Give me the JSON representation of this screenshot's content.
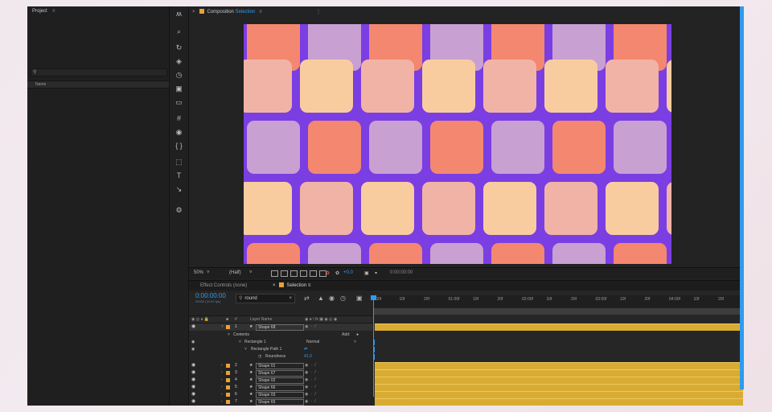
{
  "project": {
    "title": "Project",
    "search_placeholder": "",
    "column_name": "Name"
  },
  "tools": [
    {
      "icon": "puppet-pin-icon",
      "glyph": "ʍ"
    },
    {
      "icon": "search-icon",
      "glyph": "⌕"
    },
    {
      "icon": "rotate-icon",
      "glyph": "↻"
    },
    {
      "icon": "layers-icon",
      "glyph": "◈"
    },
    {
      "icon": "timer-icon",
      "glyph": "◷"
    },
    {
      "icon": "media-icon",
      "glyph": "▣"
    },
    {
      "icon": "folder-icon",
      "glyph": "▭"
    },
    {
      "icon": "grid-icon",
      "glyph": "#"
    },
    {
      "icon": "eye-icon",
      "glyph": "◉"
    },
    {
      "icon": "braces-icon",
      "glyph": "{ }"
    },
    {
      "icon": "shapes-icon",
      "glyph": "⬚"
    },
    {
      "icon": "text-icon",
      "glyph": "T"
    },
    {
      "icon": "pen-icon",
      "glyph": "↘"
    },
    {
      "icon": "settings-icon",
      "glyph": "⚙"
    }
  ],
  "composition": {
    "tab_prefix": "Composition",
    "tab_name": "Selection",
    "colors": {
      "coral": "#f4876f",
      "lavender": "#c8a0d2",
      "peach": "#f9cca0",
      "pink": "#f2b3a7",
      "purple": "#7b3ee2"
    },
    "tile_rows": [
      [
        "coral",
        "lavender",
        "coral",
        "lavender",
        "coral",
        "lavender",
        "coral"
      ],
      [
        "pink",
        "peach",
        "pink",
        "peach",
        "pink",
        "peach",
        "pink",
        "peach"
      ],
      [
        "lavender",
        "coral",
        "lavender",
        "coral",
        "lavender",
        "coral",
        "lavender"
      ],
      [
        "peach",
        "pink",
        "peach",
        "pink",
        "peach",
        "pink",
        "peach",
        "pink"
      ],
      [
        "coral",
        "lavender",
        "coral",
        "lavender",
        "coral",
        "lavender",
        "coral"
      ]
    ]
  },
  "viewer_bar": {
    "zoom": "50%",
    "resolution": "(Half)",
    "exposure": "+0.0",
    "timecode": "0:00:00:00"
  },
  "timeline": {
    "tabs": {
      "effect_controls": "Effect Controls (none)",
      "comp": "Selection"
    },
    "timecode": "0:00:00:00",
    "subtime": "00000 (24.00 fps)",
    "search_value": "round",
    "column_layer_name": "Layer Name",
    "ruler_ticks": [
      ":00f",
      "10f",
      "20f",
      "01:00f",
      "10f",
      "20f",
      "02:00f",
      "10f",
      "20f",
      "03:00f",
      "10f",
      "20f",
      "04:00f",
      "10f",
      "20f"
    ],
    "layers": [
      {
        "num": "1",
        "name": "Shape 68"
      },
      {
        "num": "2",
        "name": "Shape 01"
      },
      {
        "num": "3",
        "name": "Shape 67"
      },
      {
        "num": "4",
        "name": "Shape 02"
      },
      {
        "num": "5",
        "name": "Shape 66"
      },
      {
        "num": "6",
        "name": "Shape 03"
      },
      {
        "num": "7",
        "name": "Shape 65"
      }
    ],
    "contents_label": "Contents",
    "add_label": "Add:",
    "rect_label": "Rectangle 1",
    "blend_mode": "Normal",
    "rect_path_label": "Rectangle Path 1",
    "roundness_label": "Roundness",
    "roundness_value": "41.0"
  }
}
